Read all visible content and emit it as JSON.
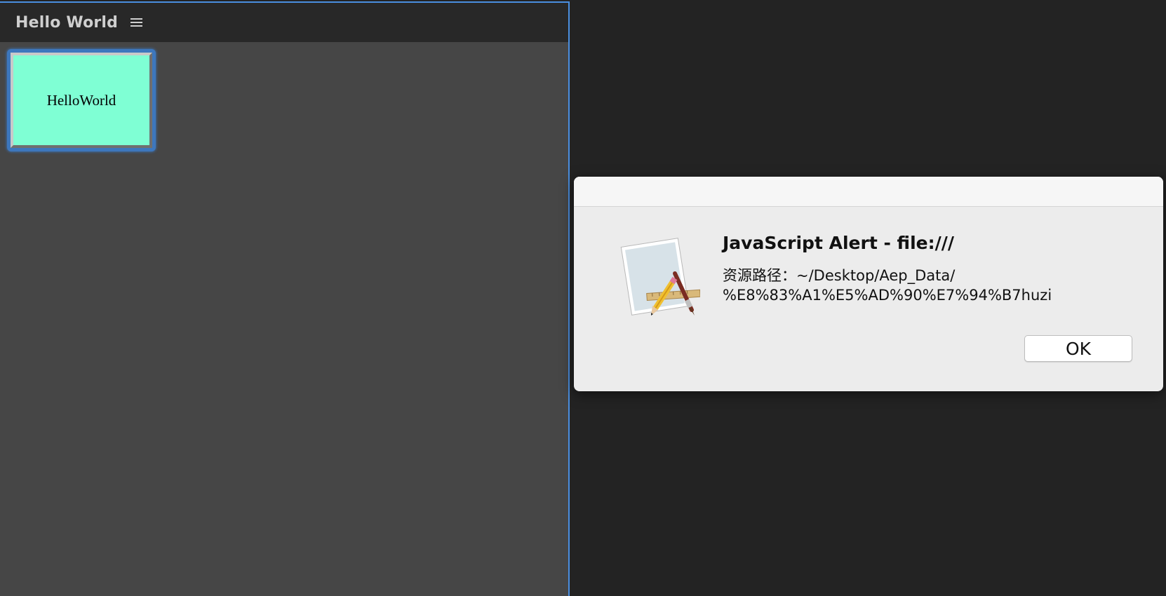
{
  "panel": {
    "title": "Hello World",
    "menu_icon": "hamburger-menu-icon",
    "button_label": "HelloWorld",
    "button_color": "#7fffd4",
    "focus_color": "#3d77bd"
  },
  "alert": {
    "icon": "script-editor-app-icon",
    "title": "JavaScript Alert - file:///",
    "message_lines": [
      "资源路径：~/Desktop/Aep_Data/",
      "%E8%83%A1%E5%AD%90%E7%94%B7huzi"
    ],
    "ok_label": "OK"
  }
}
